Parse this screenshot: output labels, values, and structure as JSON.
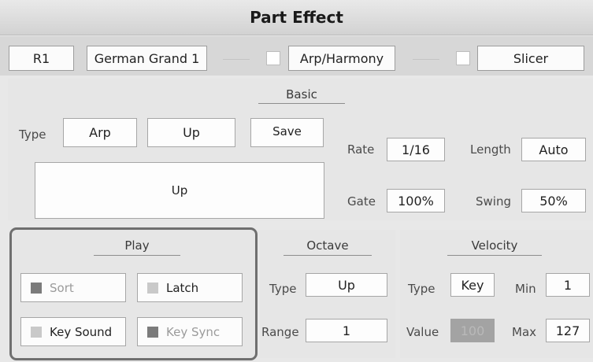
{
  "title": "Part Effect",
  "header": {
    "part": "R1",
    "voice": "German Grand 1",
    "arp_label": "Arp/Harmony",
    "slicer_label": "Slicer"
  },
  "basic": {
    "section_title": "Basic",
    "type_label": "Type",
    "type_value": "Arp",
    "pattern": "Up",
    "save_label": "Save",
    "display": "Up",
    "rate_label": "Rate",
    "rate_value": "1/16",
    "length_label": "Length",
    "length_value": "Auto",
    "gate_label": "Gate",
    "gate_value": "100%",
    "swing_label": "Swing",
    "swing_value": "50%"
  },
  "play": {
    "section_title": "Play",
    "sort_label": "Sort",
    "latch_label": "Latch",
    "key_sound_label": "Key Sound",
    "key_sync_label": "Key Sync"
  },
  "octave": {
    "section_title": "Octave",
    "type_label": "Type",
    "type_value": "Up",
    "range_label": "Range",
    "range_value": "1"
  },
  "velocity": {
    "section_title": "Velocity",
    "type_label": "Type",
    "type_value": "Key",
    "min_label": "Min",
    "min_value": "1",
    "value_label": "Value",
    "value_value": "100",
    "max_label": "Max",
    "max_value": "127"
  },
  "colors": {
    "highlight_border": "#6f6f6f",
    "led_active": "#7b7b7b",
    "led_inactive": "#c9c9c9",
    "disabled_field": "#a3a3a3"
  }
}
